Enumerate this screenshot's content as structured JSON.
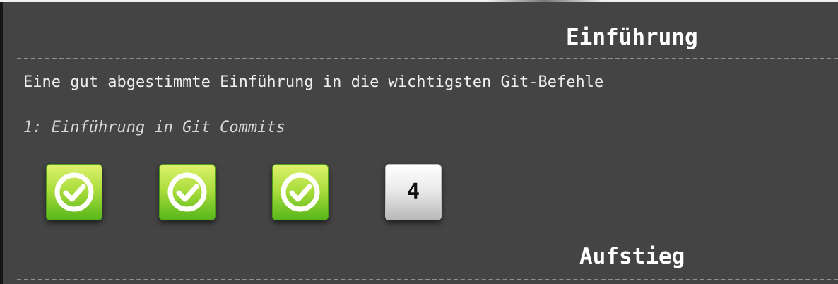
{
  "sections": [
    {
      "title": "Einführung",
      "description": "Eine gut abgestimmte Einführung in die wichtigsten Git-Befehle",
      "level_group": "1: Einführung in Git Commits",
      "levels": [
        {
          "state": "solved",
          "icon": "check-circle-icon"
        },
        {
          "state": "solved",
          "icon": "check-circle-icon"
        },
        {
          "state": "solved",
          "icon": "check-circle-icon"
        },
        {
          "state": "unsolved",
          "number": "4"
        }
      ]
    },
    {
      "title": "Aufstieg"
    }
  ],
  "colors": {
    "panel_background": "#444444",
    "solved_tile_top": "#dff26d",
    "solved_tile_bottom": "#58b71b",
    "unsolved_tile_top": "#ffffff",
    "unsolved_tile_bottom": "#b8b8b8",
    "divider": "#8f8f8f"
  }
}
